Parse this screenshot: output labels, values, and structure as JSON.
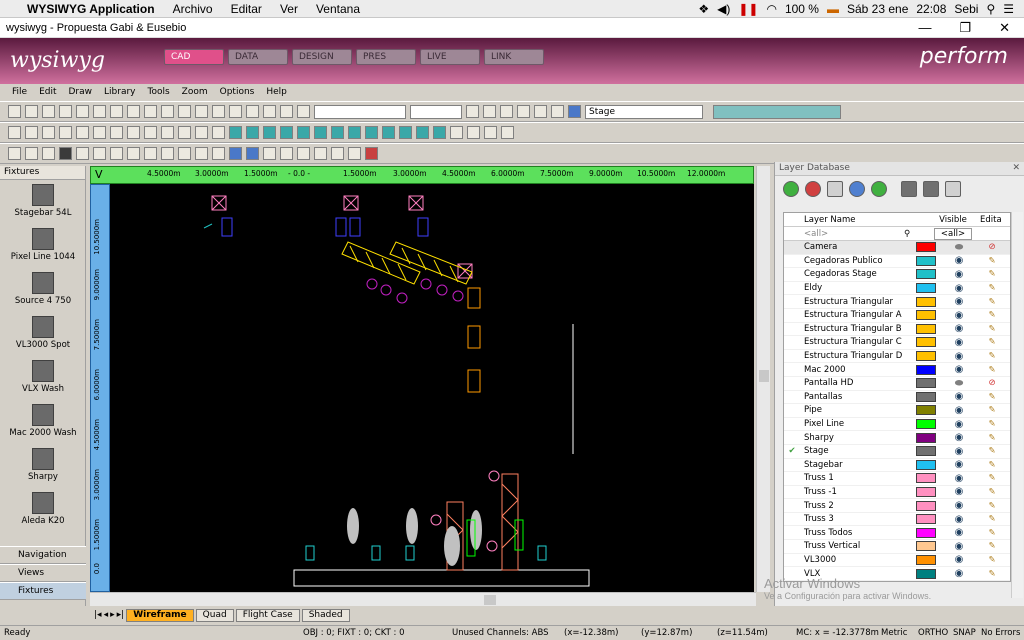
{
  "macbar": {
    "apple": "",
    "app": "WYSIWYG Application",
    "menus": [
      "Archivo",
      "Editar",
      "Ver",
      "Ventana"
    ],
    "battery": "100 %",
    "date": "Sáb 23 ene",
    "time": "22:08",
    "user": "Sebi"
  },
  "window": {
    "title": "wysiwyg - Propuesta Gabi & Eusebio",
    "minimize": "—",
    "restore": "❐",
    "close": "✕"
  },
  "banner": {
    "logo": "wysiwyg",
    "tabs": [
      "CAD",
      "DATA",
      "DESIGN",
      "PRES",
      "LIVE",
      "LINK"
    ],
    "active_tab": "CAD",
    "mode": "perform"
  },
  "menu": [
    "File",
    "Edit",
    "Draw",
    "Library",
    "Tools",
    "Zoom",
    "Options",
    "Help"
  ],
  "toolbar": {
    "layer_select": "Stage"
  },
  "fixtures_panel": {
    "title": "Fixtures",
    "items": [
      "Stagebar 54L",
      "Pixel Line 1044",
      "Source 4 750",
      "VL3000 Spot",
      "VLX Wash",
      "Mac 2000 Wash",
      "Sharpy",
      "Aleda K20"
    ],
    "nav": [
      "Navigation",
      "Views",
      "Fixtures"
    ]
  },
  "rulers": {
    "top": [
      "4.5000m",
      "3.0000m",
      "1.5000m",
      "- 0.0 -",
      "1.5000m",
      "3.0000m",
      "4.5000m",
      "6.0000m",
      "7.5000m",
      "9.0000m",
      "10.5000m",
      "12.0000m"
    ],
    "left": [
      "10.5000m",
      "9.0000m",
      "7.5000m",
      "6.0000m",
      "4.5000m",
      "3.0000m",
      "1.5000m",
      "0.0"
    ]
  },
  "view_tabs": [
    "Wireframe",
    "Quad",
    "Flight Case",
    "Shaded"
  ],
  "active_view": "Wireframe",
  "layer_db": {
    "title": "Layer Database",
    "col_name": "Layer Name",
    "col_visible": "Visible",
    "col_edit": "Edita",
    "filter_name": "<all>",
    "filter_visible": "<all>",
    "layers": [
      {
        "name": "Camera",
        "color": "#ff0000",
        "visible": "grey",
        "locked": true,
        "current": false
      },
      {
        "name": "Cegadoras Publico",
        "color": "#20c0c8",
        "visible": "eye",
        "locked": false,
        "current": false
      },
      {
        "name": "Cegadoras Stage",
        "color": "#20c0c8",
        "visible": "eye",
        "locked": false,
        "current": false
      },
      {
        "name": "Eldy",
        "color": "#20c0f0",
        "visible": "eye",
        "locked": false,
        "current": false
      },
      {
        "name": "Estructura Triangular",
        "color": "#ffc000",
        "visible": "eye",
        "locked": false,
        "current": false
      },
      {
        "name": "Estructura Triangular A",
        "color": "#ffc000",
        "visible": "eye",
        "locked": false,
        "current": false
      },
      {
        "name": "Estructura Triangular B",
        "color": "#ffc000",
        "visible": "eye",
        "locked": false,
        "current": false
      },
      {
        "name": "Estructura Triangular C",
        "color": "#ffc000",
        "visible": "eye",
        "locked": false,
        "current": false
      },
      {
        "name": "Estructura Triangular D",
        "color": "#ffc000",
        "visible": "eye",
        "locked": false,
        "current": false
      },
      {
        "name": "Mac 2000",
        "color": "#0000ff",
        "visible": "eye",
        "locked": false,
        "current": false
      },
      {
        "name": "Pantalla HD",
        "color": "#707070",
        "visible": "grey",
        "locked": true,
        "current": false
      },
      {
        "name": "Pantallas",
        "color": "#707070",
        "visible": "eye",
        "locked": false,
        "current": false
      },
      {
        "name": "Pipe",
        "color": "#808000",
        "visible": "eye",
        "locked": false,
        "current": false
      },
      {
        "name": "Pixel Line",
        "color": "#00ff00",
        "visible": "eye",
        "locked": false,
        "current": false
      },
      {
        "name": "Sharpy",
        "color": "#800080",
        "visible": "eye",
        "locked": false,
        "current": false
      },
      {
        "name": "Stage",
        "color": "#707070",
        "visible": "eye",
        "locked": false,
        "current": true
      },
      {
        "name": "Stagebar",
        "color": "#20c0f0",
        "visible": "eye",
        "locked": false,
        "current": false
      },
      {
        "name": "Truss 1",
        "color": "#ff90c0",
        "visible": "eye",
        "locked": false,
        "current": false
      },
      {
        "name": "Truss -1",
        "color": "#ff90c0",
        "visible": "eye",
        "locked": false,
        "current": false
      },
      {
        "name": "Truss 2",
        "color": "#ff90c0",
        "visible": "eye",
        "locked": false,
        "current": false
      },
      {
        "name": "Truss 3",
        "color": "#ff90c0",
        "visible": "eye",
        "locked": false,
        "current": false
      },
      {
        "name": "Truss Todos",
        "color": "#ff00ff",
        "visible": "eye",
        "locked": false,
        "current": false
      },
      {
        "name": "Truss Vertical",
        "color": "#ffc890",
        "visible": "eye",
        "locked": false,
        "current": false
      },
      {
        "name": "VL3000",
        "color": "#ff9000",
        "visible": "eye",
        "locked": false,
        "current": false
      },
      {
        "name": "VLX",
        "color": "#008080",
        "visible": "eye",
        "locked": false,
        "current": false
      }
    ]
  },
  "status": {
    "ready": "Ready",
    "obj": "OBJ : 0; FIXT : 0; CKT : 0",
    "unused": "Unused Channels: ABS",
    "x": "(x=-12.38m)",
    "y": "(y=12.87m)",
    "z": "(z=11.54m)",
    "mc": "MC: x = -12.3778m",
    "metric": "Metric",
    "ortho": "ORTHO",
    "snap": "SNAP",
    "errors": "No Errors"
  },
  "watermark": {
    "line1": "Activar Windows",
    "line2": "Ve a Configuración para activar Windows."
  }
}
